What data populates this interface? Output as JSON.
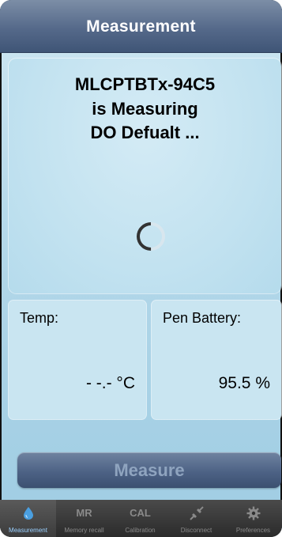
{
  "header": {
    "title": "Measurement"
  },
  "status": {
    "line1": "MLCPTBTx-94C5",
    "line2": "is Measuring",
    "line3": "DO Defualt ..."
  },
  "temp": {
    "label": "Temp:",
    "value": "- -.- °C"
  },
  "battery": {
    "label": "Pen Battery:",
    "value": "95.5 %"
  },
  "measure_button": {
    "label": "Measure"
  },
  "tabs": [
    {
      "label": "Measurement",
      "icon": "water-drop-icon",
      "active": true
    },
    {
      "label": "Memory recall",
      "icon_text": "MR"
    },
    {
      "label": "Calibration",
      "icon_text": "CAL"
    },
    {
      "label": "Disconnect",
      "icon": "disconnect-icon"
    },
    {
      "label": "Preferences",
      "icon": "gear-icon"
    }
  ],
  "colors": {
    "header_bg": "#55698a",
    "panel_bg": "#c2e2f0",
    "active_tab_label": "#9bd0ff",
    "drop_icon": "#4a9fe0"
  }
}
